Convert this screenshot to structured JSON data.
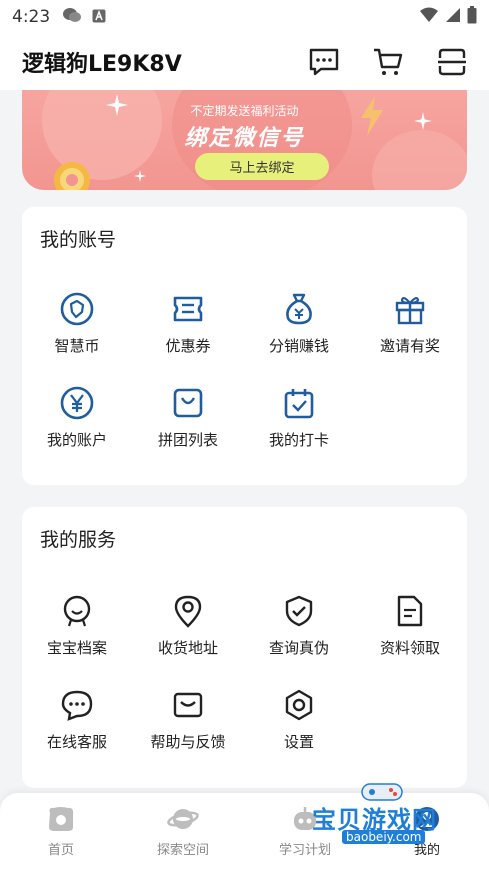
{
  "status_bar": {
    "time": "4:23"
  },
  "header": {
    "title": "逻辑狗LE9K8V"
  },
  "banner": {
    "subtitle": "不定期发送福利活动",
    "title": "绑定微信号",
    "button": "马上去绑定"
  },
  "account": {
    "title": "我的账号",
    "items": [
      {
        "label": "智慧币",
        "icon": "coin-icon"
      },
      {
        "label": "优惠券",
        "icon": "coupon-icon"
      },
      {
        "label": "分销赚钱",
        "icon": "money-bag-icon"
      },
      {
        "label": "邀请有奖",
        "icon": "gift-icon"
      },
      {
        "label": "我的账户",
        "icon": "yen-icon"
      },
      {
        "label": "拼团列表",
        "icon": "shopping-bag-icon"
      },
      {
        "label": "我的打卡",
        "icon": "calendar-check-icon"
      }
    ]
  },
  "services": {
    "title": "我的服务",
    "items": [
      {
        "label": "宝宝档案",
        "icon": "baby-profile-icon"
      },
      {
        "label": "收货地址",
        "icon": "location-pin-icon"
      },
      {
        "label": "查询真伪",
        "icon": "shield-check-icon"
      },
      {
        "label": "资料领取",
        "icon": "document-icon"
      },
      {
        "label": "在线客服",
        "icon": "chat-bubble-icon"
      },
      {
        "label": "帮助与反馈",
        "icon": "envelope-icon"
      },
      {
        "label": "设置",
        "icon": "settings-hexagon-icon"
      }
    ]
  },
  "tabbar": {
    "items": [
      {
        "label": "首页",
        "icon": "home-icon"
      },
      {
        "label": "探索空间",
        "icon": "planet-icon"
      },
      {
        "label": "学习计划",
        "icon": "robot-icon"
      },
      {
        "label": "我的",
        "icon": "profile-icon"
      }
    ]
  },
  "watermark": {
    "text": "宝贝游戏网",
    "url": "baobeiy.com"
  },
  "colors": {
    "accent": "#1f5d9e",
    "banner": "#f29590",
    "banner_button": "#e8f07c",
    "watermark": "#1f7fd8"
  }
}
